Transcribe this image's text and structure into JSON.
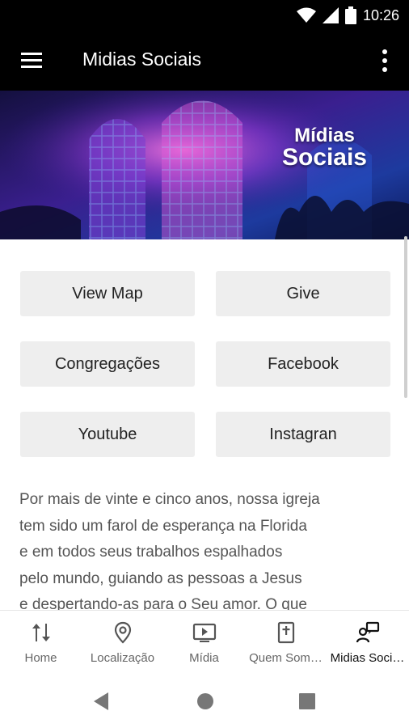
{
  "status_bar": {
    "time": "10:26",
    "icons": [
      "wifi-icon",
      "signal-icon",
      "battery-icon"
    ]
  },
  "app_bar": {
    "title": "Midias Sociais",
    "icons": [
      "menu-icon",
      "more-vert-icon"
    ]
  },
  "banner": {
    "line1": "Mídias",
    "line2": "Sociais"
  },
  "buttons": [
    {
      "label": "View Map"
    },
    {
      "label": "Give"
    },
    {
      "label": "Congregações"
    },
    {
      "label": "Facebook"
    },
    {
      "label": "Youtube"
    },
    {
      "label": "Instagran"
    }
  ],
  "description": {
    "lines": [
      "Por mais de vinte e cinco anos, nossa igreja",
      "tem sido um farol de esperança na Florida",
      "e em todos seus trabalhos espalhados",
      "pelo mundo, guiando as pessoas a Jesus",
      "e despertando-as para o Seu amor. O que"
    ]
  },
  "bottom_nav": {
    "active_index": 4,
    "items": [
      {
        "label": "Home",
        "icon": "sort-arrows-icon"
      },
      {
        "label": "Localização",
        "icon": "location-pin-icon"
      },
      {
        "label": "Mídia",
        "icon": "video-play-icon"
      },
      {
        "label": "Quem Som…",
        "icon": "bible-icon"
      },
      {
        "label": "Midias Soci…",
        "icon": "social-media-icon"
      }
    ]
  },
  "colors": {
    "appbar_bg": "#000000",
    "button_bg": "#eeeeee",
    "text_dark": "#222222",
    "text_muted": "#555555"
  }
}
